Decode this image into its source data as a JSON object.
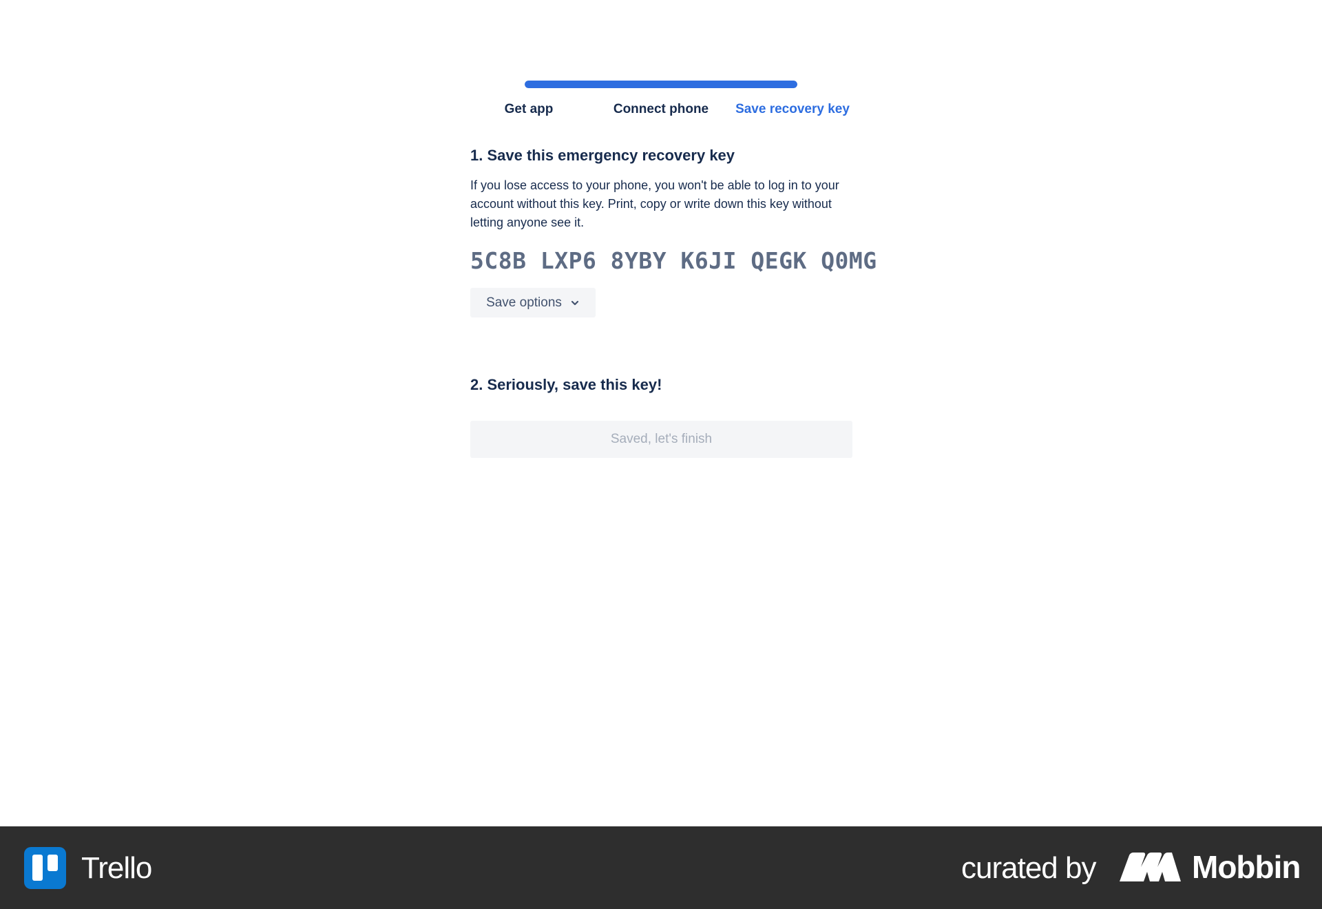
{
  "stepper": {
    "progress_percent": 100,
    "steps": [
      {
        "label": "Get app",
        "state": "complete"
      },
      {
        "label": "Connect phone",
        "state": "complete"
      },
      {
        "label": "Save recovery key",
        "state": "active"
      }
    ]
  },
  "section1": {
    "heading": "1. Save this emergency recovery key",
    "description": "If you lose access to your phone, you won't be able to log in to your account without this key. Print, copy or write down this key without letting anyone see it.",
    "recovery_key": "5C8B LXP6 8YBY K6JI QEGK Q0MG",
    "save_options_label": "Save options",
    "save_options_icon": "chevron-down-icon"
  },
  "section2": {
    "heading": "2. Seriously, save this key!",
    "finish_button_label": "Saved, let's finish",
    "finish_button_enabled": false
  },
  "footer": {
    "app_name": "Trello",
    "app_icon": "trello-logo-icon",
    "curated_by": "curated by",
    "curator_name": "Mobbin",
    "curator_icon": "mobbin-logo-icon"
  },
  "colors": {
    "accent": "#2d6de0",
    "text_primary": "#172b4d",
    "key_text": "#5e6c84",
    "button_bg": "#f4f5f7",
    "disabled_text": "#a5adba",
    "footer_bg": "#2e2e2e",
    "trello_blue": "#0a79d1"
  }
}
